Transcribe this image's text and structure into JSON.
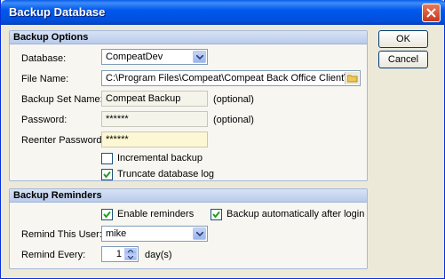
{
  "window": {
    "title": "Backup Database"
  },
  "buttons": {
    "ok": "OK",
    "cancel": "Cancel"
  },
  "backup_options": {
    "title": "Backup Options",
    "database": {
      "label": "Database:",
      "value": "CompeatDev"
    },
    "file_name": {
      "label": "File Name:",
      "value": "C:\\Program Files\\Compeat\\Compeat Back Office Client\\CompeatD"
    },
    "backup_set_name": {
      "label": "Backup Set Name:",
      "value": "Compeat Backup",
      "note": "(optional)"
    },
    "password": {
      "label": "Password:",
      "value": "******",
      "note": "(optional)"
    },
    "reenter_password": {
      "label": "Reenter Password:",
      "value": "******"
    },
    "incremental_backup": {
      "label": "Incremental backup",
      "checked": false
    },
    "truncate_log": {
      "label": "Truncate database log",
      "checked": true
    }
  },
  "backup_reminders": {
    "title": "Backup Reminders",
    "enable_reminders": {
      "label": "Enable reminders",
      "checked": true
    },
    "backup_after_login": {
      "label": "Backup automatically after login",
      "checked": true
    },
    "remind_user": {
      "label": "Remind This User:",
      "value": "mike"
    },
    "remind_every": {
      "label": "Remind Every:",
      "value": "1",
      "unit": "day(s)"
    }
  }
}
